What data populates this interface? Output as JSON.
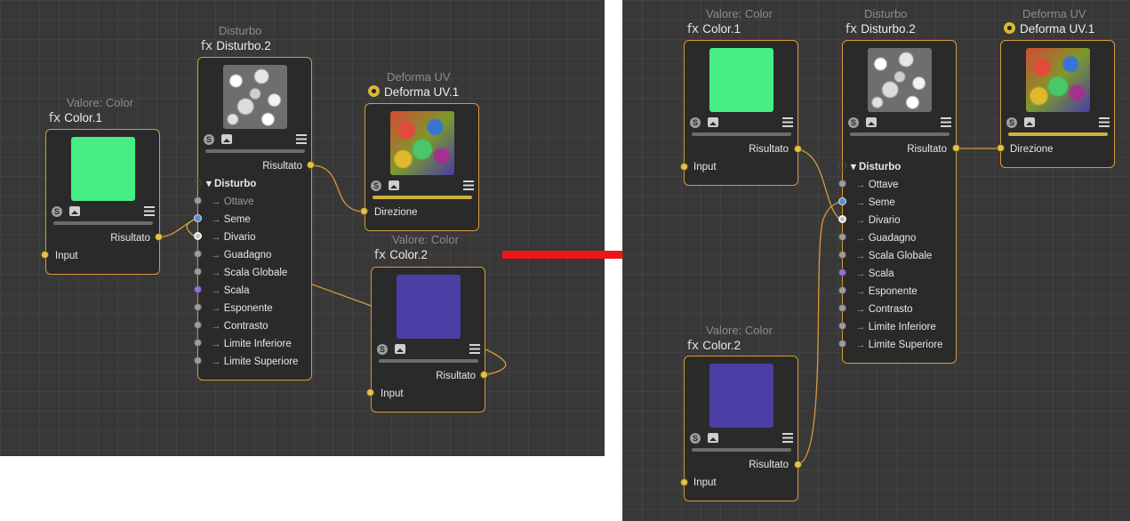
{
  "panel_left": {
    "color1": {
      "type": "Valore: Color",
      "name": "Color.1",
      "prefix": "fx",
      "out": "Risultato",
      "in": "Input"
    },
    "disturbo2": {
      "type": "Disturbo",
      "name": "Disturbo.2",
      "prefix": "fx",
      "out": "Risultato",
      "group": "Disturbo",
      "params": [
        "Ottave",
        "Seme",
        "Divario",
        "Guadagno",
        "Scala Globale",
        "Scala",
        "Esponente",
        "Contrasto",
        "Limite Inferiore",
        "Limite Superiore"
      ]
    },
    "deforma": {
      "type": "Deforma UV",
      "name": "Deforma UV.1",
      "in": "Direzione"
    },
    "color2": {
      "type": "Valore: Color",
      "name": "Color.2",
      "prefix": "fx",
      "out": "Risultato",
      "in": "Input"
    }
  },
  "panel_right": {
    "color1": {
      "type": "Valore: Color",
      "name": "Color.1",
      "prefix": "fx",
      "out": "Risultato",
      "in": "Input"
    },
    "disturbo2": {
      "type": "Disturbo",
      "name": "Disturbo.2",
      "prefix": "fx",
      "out": "Risultato",
      "group": "Disturbo",
      "params": [
        "Ottave",
        "Seme",
        "Divario",
        "Guadagno",
        "Scala Globale",
        "Scala",
        "Esponente",
        "Contrasto",
        "Limite Inferiore",
        "Limite Superiore"
      ]
    },
    "deforma": {
      "type": "Deforma UV",
      "name": "Deforma UV.1",
      "in": "Direzione"
    },
    "color2": {
      "type": "Valore: Color",
      "name": "Color.2",
      "prefix": "fx",
      "out": "Risultato",
      "in": "Input"
    }
  },
  "colors": {
    "node_border": "#d89a3c",
    "wire": "#d89a3c",
    "arrow": "#f01414",
    "color1_swatch": "#47ee86",
    "color2_swatch": "#4b3fa6"
  }
}
